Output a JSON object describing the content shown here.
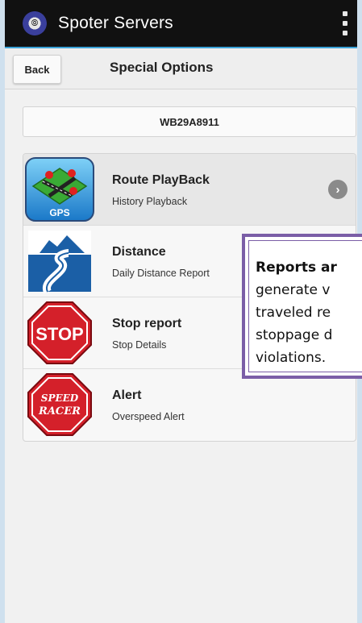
{
  "app": {
    "title": "Spoter Servers",
    "logo_icon": "spoter-logo-icon"
  },
  "toolbar": {
    "back_label": "Back",
    "title": "Special Options"
  },
  "vehicle": {
    "number": "WB29A8911"
  },
  "options": [
    {
      "title": "Route PlayBack",
      "subtitle": "History Playback",
      "icon": "gps-map-icon",
      "icon_text": "GPS"
    },
    {
      "title": "Distance",
      "subtitle": "Daily Distance Report",
      "icon": "road-distance-icon"
    },
    {
      "title": "Stop report",
      "subtitle": "Stop Details",
      "icon": "stop-sign-icon",
      "icon_text": "STOP"
    },
    {
      "title": "Alert",
      "subtitle": "Overspeed Alert",
      "icon": "speed-racer-icon",
      "icon_text_1": "SPEED",
      "icon_text_2": "RACER"
    }
  ],
  "callout": {
    "lead": "Reports ar",
    "line2": "generate v",
    "line3": "traveled re",
    "line4": "stoppage d",
    "line5": "violations."
  },
  "colors": {
    "accent": "#3aa3d8",
    "callout_border": "#7b5ea7",
    "stop_red": "#d4202a"
  }
}
